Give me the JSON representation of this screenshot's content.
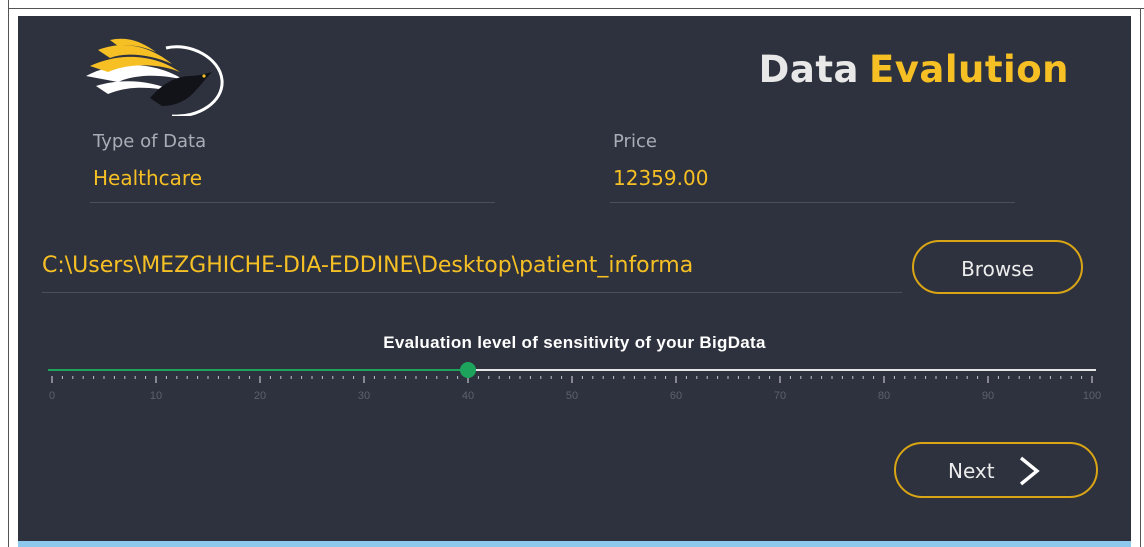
{
  "header": {
    "title_word1": "Data",
    "title_word2": "Evalution"
  },
  "fields": {
    "type_label": "Type of Data",
    "type_value": "Healthcare",
    "price_label": "Price",
    "price_value": "12359.00"
  },
  "file": {
    "path": "C:\\Users\\MEZGHICHE-DIA-EDDINE\\Desktop\\patient_informa",
    "browse_label": "Browse"
  },
  "slider": {
    "title": "Evaluation level of sensitivity of your BigData",
    "min": 0,
    "max": 100,
    "value": 40,
    "tick_labels": [
      "0",
      "10",
      "20",
      "30",
      "40",
      "50",
      "60",
      "70",
      "80",
      "90",
      "100"
    ],
    "fill_color": "#1ea35c",
    "track_color": "#e6e6e6"
  },
  "footer": {
    "next_label": "Next"
  },
  "icons": {
    "logo": "bird-logo-icon",
    "next": "chevron-right-icon"
  },
  "colors": {
    "accent": "#f6c025",
    "background": "#2e323e"
  }
}
